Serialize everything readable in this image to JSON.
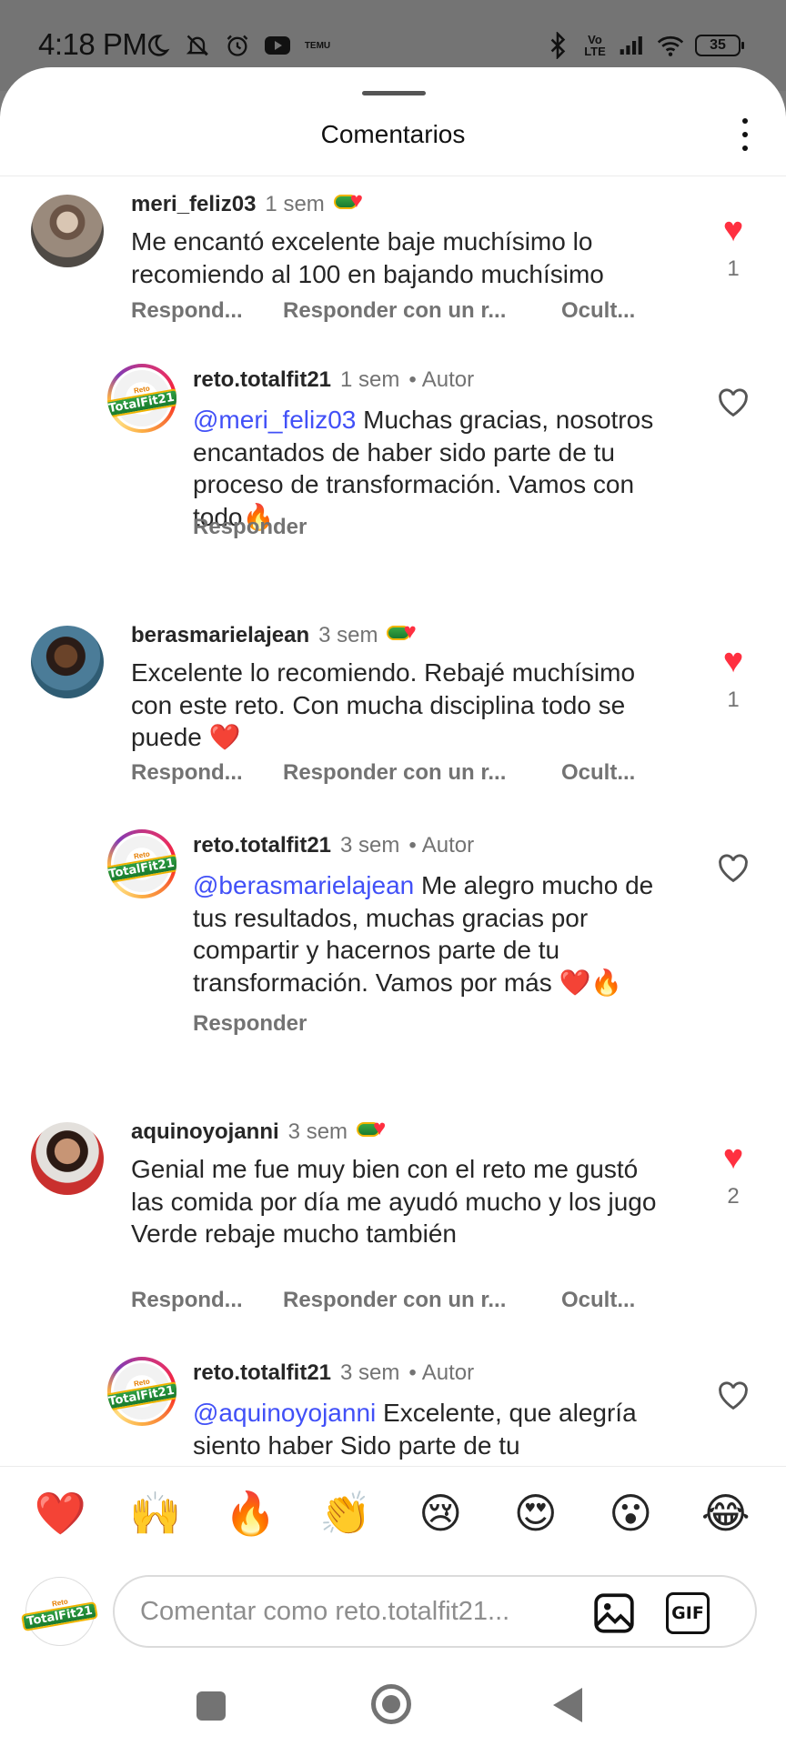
{
  "status_bar": {
    "time": "4:18 PM",
    "temu": "TEMU",
    "volte": "Vo LTE",
    "battery": "35"
  },
  "sheet": {
    "title": "Comentarios"
  },
  "comments": [
    {
      "username": "meri_feliz03",
      "time": "1 sem",
      "text": "Me encantó excelente baje muchísimo lo recomiendo al 100 en bajando muchísimo",
      "actions": [
        "Respond...",
        "Responder con un r...",
        "Ocult..."
      ],
      "likes": "1",
      "reply": {
        "username": "reto.totalfit21",
        "time": "1 sem",
        "author": "Autor",
        "mention": "@meri_feliz03",
        "text": " Muchas gracias, nosotros encantados de haber sido parte de tu proceso de transformación. Vamos con todo🔥",
        "action": "Responder"
      }
    },
    {
      "username": "berasmarielajean",
      "time": "3 sem",
      "text": "Excelente lo recomiendo. Rebajé muchísimo con este reto. Con mucha disciplina todo se puede ❤️",
      "actions": [
        "Respond...",
        "Responder con un r...",
        "Ocult..."
      ],
      "likes": "1",
      "reply": {
        "username": "reto.totalfit21",
        "time": "3 sem",
        "author": "Autor",
        "mention": "@berasmarielajean",
        "text": " Me alegro mucho de tus resultados, muchas gracias por compartir y hacernos parte de tu transformación. Vamos por más ❤️🔥",
        "action": "Responder"
      }
    },
    {
      "username": "aquinoyojanni",
      "time": "3 sem",
      "text": "Genial me fue muy bien con  el reto me gustó las comida por día me ayudó mucho y los jugo Verde rebaje mucho también",
      "actions": [
        "Respond...",
        "Responder con un r...",
        "Ocult..."
      ],
      "likes": "2",
      "reply": {
        "username": "reto.totalfit21",
        "time": "3 sem",
        "author": "Autor",
        "mention": "@aquinoyojanni",
        "text": " Excelente, que alegría siento haber Sido parte de tu",
        "action": ""
      }
    }
  ],
  "separator": "•",
  "reactions": [
    "❤️",
    "🙌",
    "🔥",
    "👏",
    "😢",
    "😍",
    "😮",
    "😂"
  ],
  "input": {
    "placeholder": "Comentar como reto.totalfit21...",
    "gif_label": "GIF"
  },
  "brand_logo": {
    "top": "Reto",
    "main": "TotalFit21"
  }
}
